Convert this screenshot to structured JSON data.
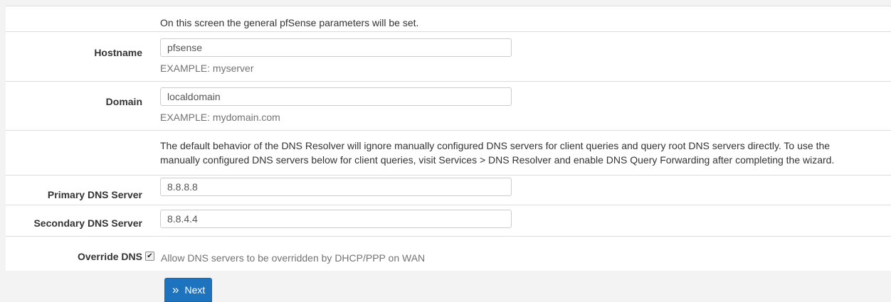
{
  "intro": {
    "text": "On this screen the general pfSense parameters will be set."
  },
  "hostname": {
    "label": "Hostname",
    "value": "pfsense",
    "help": "EXAMPLE: myserver"
  },
  "domain": {
    "label": "Domain",
    "value": "localdomain",
    "help": "EXAMPLE: mydomain.com"
  },
  "dns_note": {
    "line1": "The default behavior of the DNS Resolver will ignore manually configured DNS servers for client queries and query root DNS servers directly. To use the",
    "line2": "manually configured DNS servers below for client queries, visit Services > DNS Resolver and enable DNS Query Forwarding after completing the wizard."
  },
  "primary_dns": {
    "label": "Primary DNS Server",
    "value": "8.8.8.8"
  },
  "secondary_dns": {
    "label": "Secondary DNS Server",
    "value": "8.8.4.4"
  },
  "override_dns": {
    "label": "Override DNS",
    "checked": true,
    "text": "Allow DNS servers to be overridden by DHCP/PPP on WAN"
  },
  "next_button": {
    "icon": "double-chevron-right-icon",
    "label": "Next",
    "color": "#1e73be"
  }
}
